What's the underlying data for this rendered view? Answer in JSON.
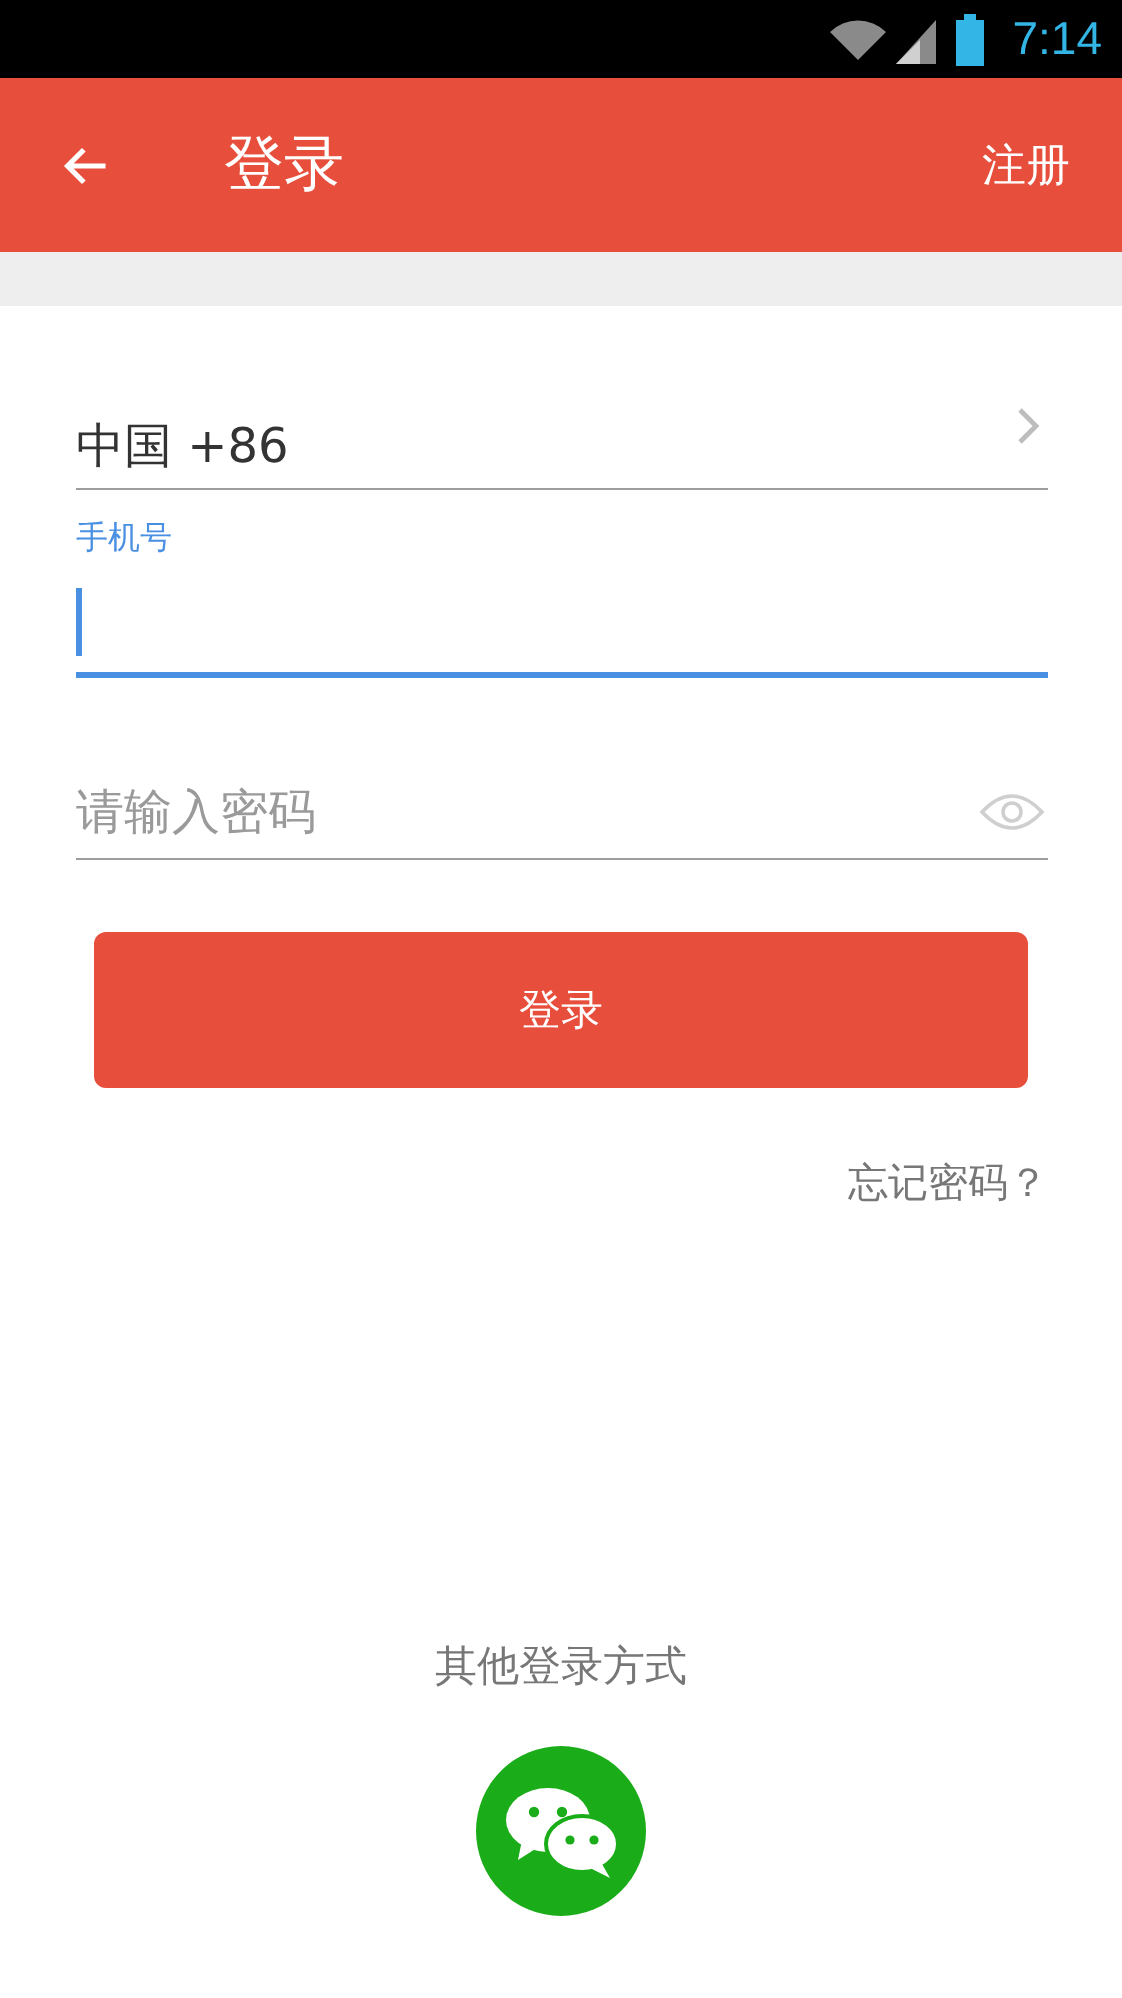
{
  "status_bar": {
    "time": "7:14"
  },
  "app_bar": {
    "title": "登录",
    "action": "注册"
  },
  "country": {
    "value": "中国 +86"
  },
  "phone": {
    "label": "手机号",
    "focused": true
  },
  "password": {
    "placeholder": "请输入密码"
  },
  "login_button": "登录",
  "forgot_link": "忘记密码？",
  "other_login": {
    "title": "其他登录方式"
  }
}
